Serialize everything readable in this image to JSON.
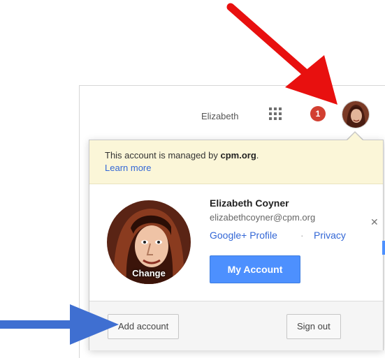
{
  "topbar": {
    "user_first_name": "Elizabeth",
    "apps_icon": "apps-grid-icon",
    "notification_count": "1"
  },
  "popup": {
    "managed_prefix": "This account is managed by ",
    "managed_domain": "cpm.org",
    "managed_suffix": ".",
    "learn_more": "Learn more",
    "avatar_change_label": "Change",
    "user_name": "Elizabeth Coyner",
    "user_email": "elizabethcoyner@cpm.org",
    "links": {
      "google_plus_profile": "Google+ Profile",
      "separator": "·",
      "privacy": "Privacy"
    },
    "my_account_button": "My Account",
    "footer": {
      "add_account_button": "Add account",
      "sign_out_button": "Sign out"
    }
  },
  "colors": {
    "annotation_red_arrow": "#e8100f",
    "annotation_blue_arrow": "#3f6fd1",
    "primary_button": "#4d90fe",
    "link": "#3367d6",
    "managed_banner": "#fbf6d8",
    "notification_badge": "#d23f31"
  }
}
